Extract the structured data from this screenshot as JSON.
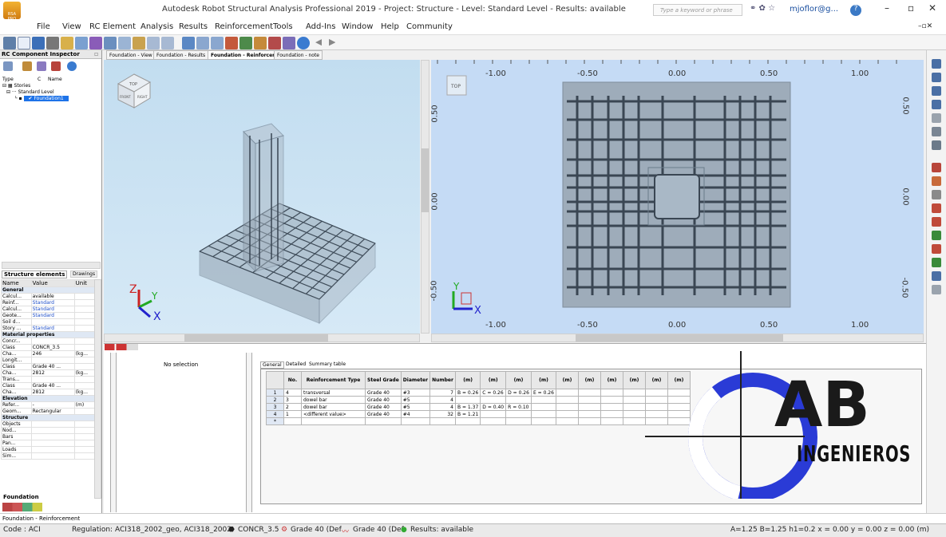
{
  "window": {
    "title": "Autodesk Robot Structural Analysis Professional 2019 - Project: Structure - Level: Standard Level - Results: available",
    "search_placeholder": "Type a keyword or phrase",
    "user": "mjoflor@g...",
    "app_logo": "RSA PRO"
  },
  "menu": [
    "File",
    "View",
    "RC Element",
    "Analysis",
    "Results",
    "Reinforcement",
    "Tools",
    "Add-Ins",
    "Window",
    "Help",
    "Community"
  ],
  "inspector": {
    "title": "RC Component Inspector",
    "col_type": "Type",
    "col_c": "C",
    "col_name": "Name",
    "tree": [
      "Stories",
      "Standard Level",
      "Foundation1"
    ],
    "tabs": [
      "Structure elements",
      "Drawings"
    ]
  },
  "doc_tabs": [
    "Foundation - View",
    "Foundation - Results",
    "Foundation - Reinforcement",
    "Foundation - note"
  ],
  "props": {
    "headers": [
      "Name",
      "Value",
      "Unit"
    ],
    "rows": [
      [
        "General",
        "",
        ""
      ],
      [
        "Calcul...",
        "available",
        ""
      ],
      [
        "Reinf...",
        "Standard",
        ""
      ],
      [
        "Calcul...",
        "Standard",
        ""
      ],
      [
        "Geote...",
        "Standard",
        ""
      ],
      [
        "Soil d...",
        "",
        ""
      ],
      [
        "Story ...",
        "Standard",
        ""
      ],
      [
        "Material properties",
        "",
        ""
      ],
      [
        "Concr...",
        "",
        ""
      ],
      [
        "Class",
        "CONCR_3.5",
        ""
      ],
      [
        "Cha...",
        "246",
        "(kg..."
      ],
      [
        "Longit...",
        "",
        ""
      ],
      [
        "Class",
        "Grade 40 ...",
        ""
      ],
      [
        "Cha...",
        "2812",
        "(kg..."
      ],
      [
        "Trans...",
        "",
        ""
      ],
      [
        "Class",
        "Grade 40 ...",
        ""
      ],
      [
        "Cha...",
        "2812",
        "(kg..."
      ],
      [
        "Elevation",
        "",
        ""
      ],
      [
        "Refer...",
        "-",
        "(m)"
      ],
      [
        "Geom...",
        "Rectangular",
        ""
      ],
      [
        "Structure",
        "",
        ""
      ],
      [
        "Objects",
        "",
        ""
      ],
      [
        "Nod...",
        "",
        ""
      ],
      [
        "Bars",
        "",
        ""
      ],
      [
        "Pan...",
        "",
        ""
      ],
      [
        "Loads",
        "",
        ""
      ],
      [
        "Sim...",
        "",
        ""
      ]
    ],
    "bottom_tab": "Foundation"
  },
  "view2d": {
    "top_ticks": [
      "-1.00",
      "-0.50",
      "0.00",
      "0.50",
      "1.00"
    ],
    "left_ticks": [
      "0.50",
      "0.00",
      "-0.50"
    ],
    "right_ticks": [
      "0.50",
      "0.00",
      "-0.50"
    ],
    "cube_label": "TOP"
  },
  "view3d": {
    "cube_faces": [
      "TOP",
      "FRONT",
      "RIGHT"
    ]
  },
  "selection_text": "No selection",
  "table": {
    "tabs": [
      "General",
      "Detailed",
      "Summary table"
    ],
    "headers": [
      "No.",
      "Reinforcement Type",
      "Steel Grade",
      "Diameter",
      "Number",
      "(m)",
      "(m)",
      "(m)",
      "(m)",
      "(m)",
      "(m)",
      "(m)",
      "(m)",
      "(m)",
      "(m)"
    ],
    "rows": [
      [
        "1",
        "4",
        "transversal",
        "Grade 40",
        "#3",
        "7",
        "B = 0.26",
        "C = 0.26",
        "D = 0.26",
        "E = 0.26"
      ],
      [
        "2",
        "3",
        "dowel bar",
        "Grade 40",
        "#5",
        "4",
        "",
        "",
        "",
        ""
      ],
      [
        "3",
        "2",
        "dowel bar",
        "Grade 40",
        "#5",
        "4",
        "B = 1.37",
        "D = 0.40",
        "R = 0.10",
        ""
      ],
      [
        "4",
        "1",
        "<different value>",
        "Grade 40",
        "#4",
        "32",
        "B = 1.21",
        "",
        "",
        ""
      ],
      [
        "*",
        "",
        "",
        "",
        "",
        "",
        "",
        "",
        "",
        ""
      ]
    ]
  },
  "logo": {
    "line1": "AB",
    "line2": "INGENIEROS",
    "color": "#2a3bd6"
  },
  "status": {
    "bottom_tab": "Foundation - Reinforcement",
    "code": "Code : ACI",
    "regulation": "Regulation: ACI318_2002_geo, ACI318_2002",
    "concrete": "CONCR_3.5",
    "steel1": "Grade 40 (Def",
    "steel2": "Grade 40 (Def",
    "results": "Results: available",
    "coords": "A=1.25 B=1.25 h1=0.2  x = 0.00 y = 0.00 z = 0.00  (m)"
  }
}
